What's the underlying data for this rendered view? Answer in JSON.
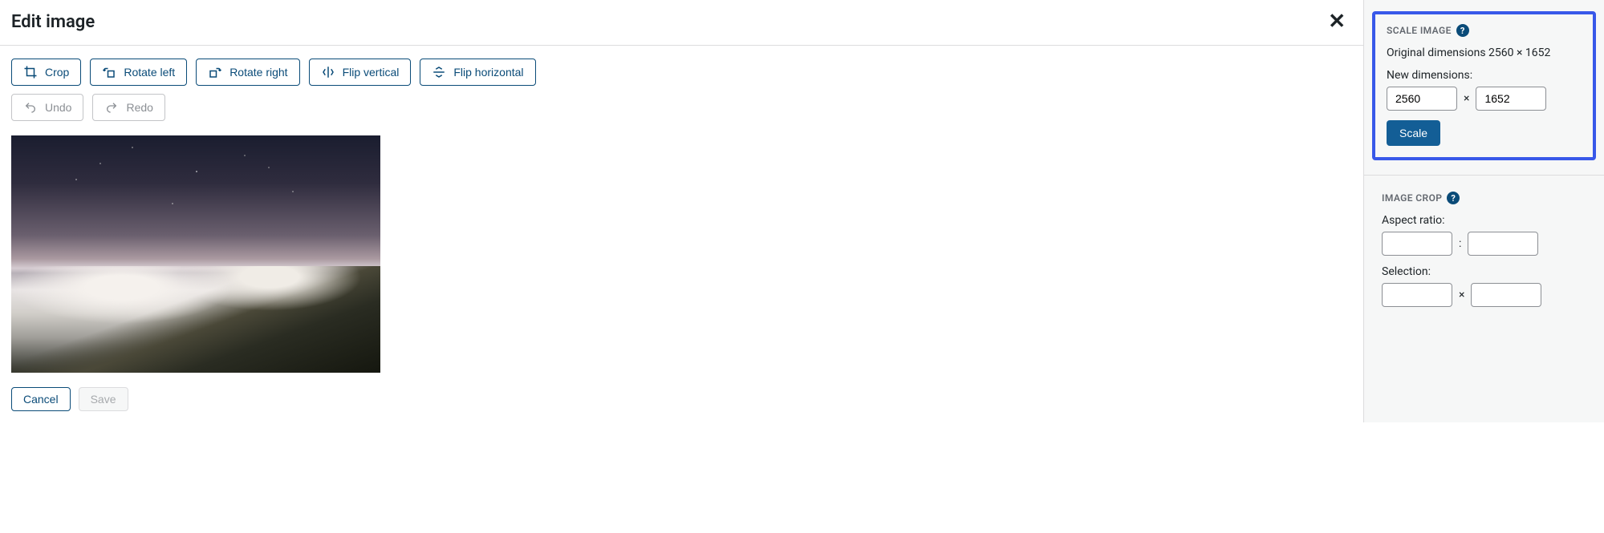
{
  "header": {
    "title": "Edit image"
  },
  "toolbar": {
    "crop": "Crop",
    "rotate_left": "Rotate left",
    "rotate_right": "Rotate right",
    "flip_vertical": "Flip vertical",
    "flip_horizontal": "Flip horizontal",
    "undo": "Undo",
    "redo": "Redo"
  },
  "actions": {
    "cancel": "Cancel",
    "save": "Save"
  },
  "scale": {
    "title": "SCALE IMAGE",
    "original_label": "Original dimensions 2560 × 1652",
    "new_dimensions_label": "New dimensions:",
    "width": "2560",
    "height": "1652",
    "separator": "×",
    "button": "Scale"
  },
  "crop": {
    "title": "IMAGE CROP",
    "aspect_ratio_label": "Aspect ratio:",
    "aspect_ratio_sep": ":",
    "aspect_w": "",
    "aspect_h": "",
    "selection_label": "Selection:",
    "selection_sep": "×",
    "selection_w": "",
    "selection_h": ""
  },
  "help_glyph": "?"
}
